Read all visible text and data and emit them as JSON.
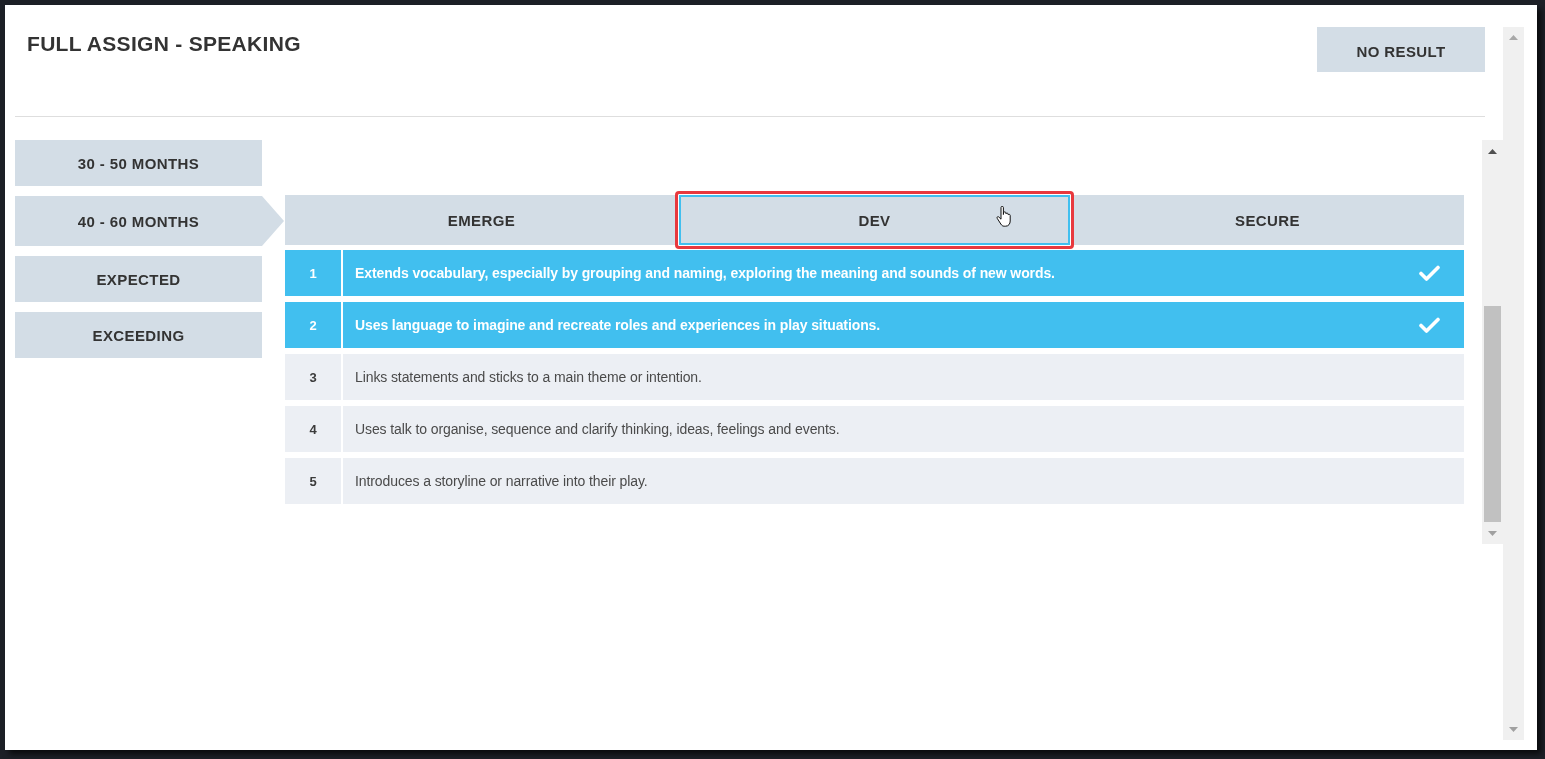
{
  "dialog": {
    "title": "FULL ASSIGN - SPEAKING",
    "action_button": "NO RESULT"
  },
  "age_bands": [
    {
      "label": "30 - 50 MONTHS",
      "selected": false
    },
    {
      "label": "40 - 60 MONTHS",
      "selected": true
    },
    {
      "label": "EXPECTED",
      "selected": false
    },
    {
      "label": "EXCEEDING",
      "selected": false
    }
  ],
  "levels": [
    {
      "label": "EMERGE",
      "selected": false,
      "highlighted": false
    },
    {
      "label": "DEV",
      "selected": true,
      "highlighted": true
    },
    {
      "label": "SECURE",
      "selected": false,
      "highlighted": false
    }
  ],
  "statements": [
    {
      "number": "1",
      "text": "Extends vocabulary, especially by grouping and naming, exploring the meaning and sounds of new words.",
      "checked": true
    },
    {
      "number": "2",
      "text": "Uses language to imagine and recreate roles and experiences in play situations.",
      "checked": true
    },
    {
      "number": "3",
      "text": "Links statements and sticks to a main theme or intention.",
      "checked": false
    },
    {
      "number": "4",
      "text": "Uses talk to organise, sequence and clarify thinking, ideas, feelings and events.",
      "checked": false
    },
    {
      "number": "5",
      "text": "Introduces a storyline or narrative into their play.",
      "checked": false
    }
  ]
}
